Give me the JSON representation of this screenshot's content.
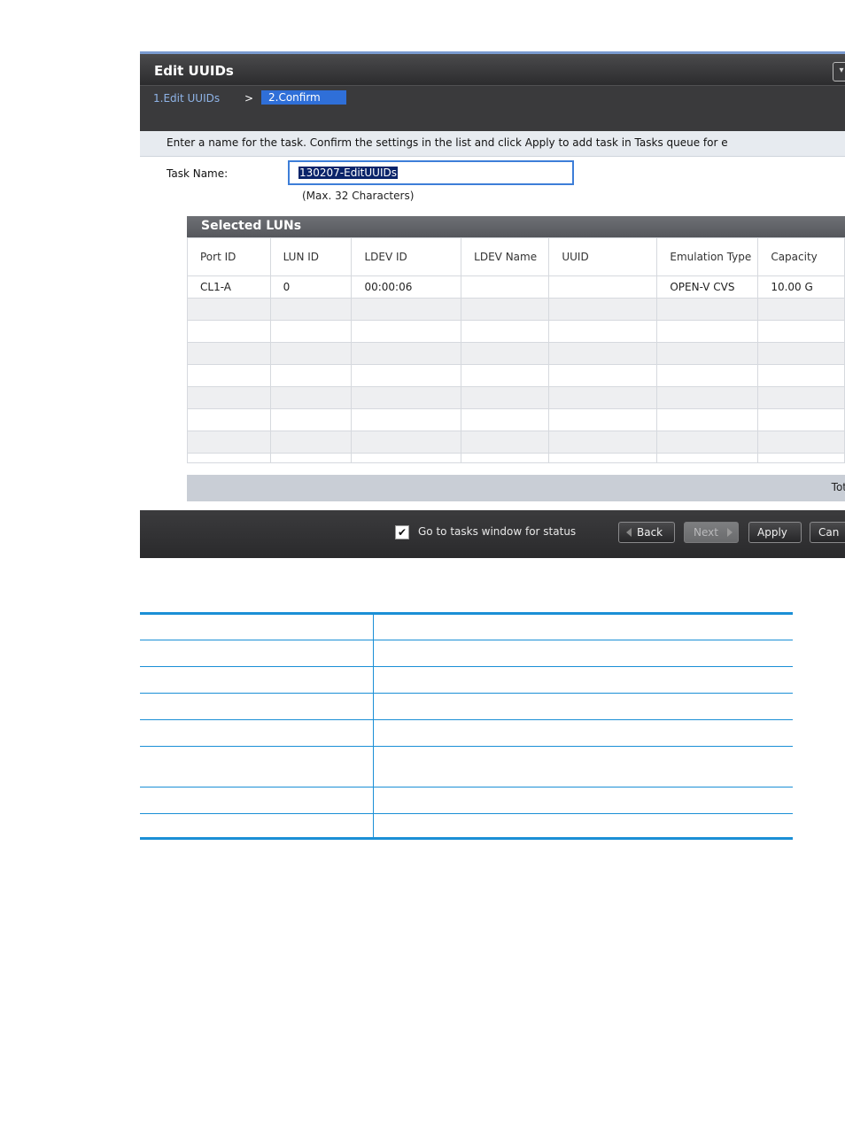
{
  "window": {
    "title": "Edit UUIDs",
    "steps": {
      "step1": "1.Edit UUIDs",
      "separator": ">",
      "step2": "2.Confirm"
    },
    "instruction": "Enter a name for the task. Confirm the settings in the list and click Apply to add task in Tasks queue for e",
    "task_name": {
      "label": "Task Name:",
      "value": "130207-EditUUIDs",
      "hint": "(Max. 32 Characters)"
    },
    "panel": {
      "title": "Selected LUNs",
      "columns": [
        "Port ID",
        "LUN ID",
        "LDEV ID",
        "LDEV Name",
        "UUID",
        "Emulation Type",
        "Capacity"
      ],
      "rows": [
        [
          "CL1-A",
          "0",
          "00:00:06",
          "",
          "",
          "OPEN-V CVS",
          "10.00 G"
        ]
      ],
      "footer": "Tot"
    },
    "footer": {
      "checkbox_label": "Go to tasks window for status",
      "checkbox_checked": true,
      "back_label": "Back",
      "next_label": "Next",
      "apply_label": "Apply",
      "cancel_label": "Can"
    }
  },
  "doc_table": {
    "rows": [
      [
        "",
        ""
      ],
      [
        "",
        ""
      ],
      [
        "",
        ""
      ],
      [
        "",
        ""
      ],
      [
        "",
        ""
      ],
      [
        "",
        ""
      ],
      [
        "",
        ""
      ],
      [
        "",
        ""
      ]
    ]
  }
}
